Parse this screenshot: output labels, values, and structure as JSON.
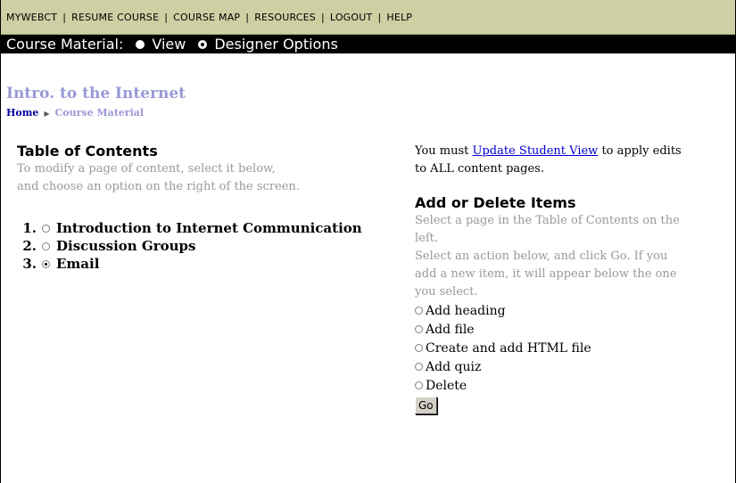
{
  "topnav": {
    "links": [
      "MYWEBCT",
      "RESUME COURSE",
      "COURSE MAP",
      "RESOURCES",
      "LOGOUT",
      "HELP"
    ],
    "separator": "|"
  },
  "material_bar": {
    "label": "Course Material:",
    "view_label": "View",
    "designer_label": "Designer Options",
    "selected": "designer"
  },
  "course": {
    "title": "Intro. to the Internet"
  },
  "breadcrumb": {
    "home": "Home",
    "current": "Course Material"
  },
  "toc": {
    "heading": "Table of Contents",
    "instructions_line1": "To modify a page of content, select it below,",
    "instructions_line2": "and choose an option on the right of the screen.",
    "items": [
      {
        "num": "1.",
        "label": "Introduction to Internet Communication",
        "checked": false
      },
      {
        "num": "2.",
        "label": "Discussion Groups",
        "checked": false
      },
      {
        "num": "3.",
        "label": "Email",
        "checked": true
      }
    ]
  },
  "update": {
    "prefix": "You must ",
    "link": "Update Student View",
    "suffix_line1": " to apply edits",
    "line2": "to ALL content pages."
  },
  "add_delete": {
    "heading": "Add or Delete Items",
    "instructions_line1": "Select a page in the Table of Contents on the",
    "instructions_line2": "left.",
    "instructions_line3": "Select an action below, and click Go. If you",
    "instructions_line4": "add a new item, it will appear below the one",
    "instructions_line5": "you select.",
    "options": [
      "Add heading",
      "Add file",
      "Create and add HTML file",
      "Add quiz",
      "Delete"
    ],
    "go_label": "Go"
  }
}
